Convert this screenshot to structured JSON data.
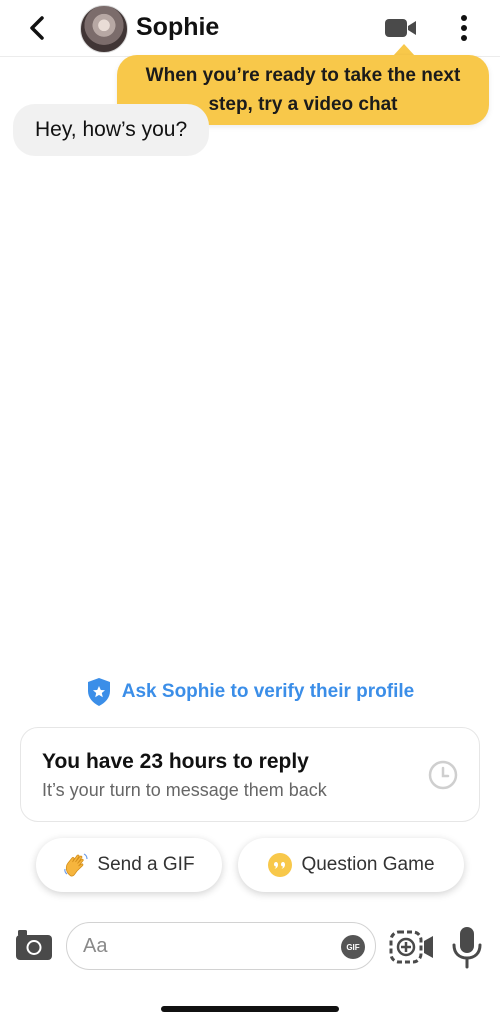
{
  "header": {
    "contact_name": "Sophie"
  },
  "tooltip": {
    "text": "When you’re ready to take the next step, try a video chat"
  },
  "messages": [
    {
      "text": "Hey, how’s you?"
    }
  ],
  "verify": {
    "text": "Ask Sophie to verify their profile"
  },
  "reply_card": {
    "title": "You have 23 hours to reply",
    "subtitle": "It’s your turn to message them back"
  },
  "chips": {
    "gif_label": "Send a GIF",
    "question_label": "Question Game"
  },
  "composer": {
    "placeholder": "Aa",
    "gif_badge": "GIF"
  },
  "colors": {
    "accent_yellow": "#f8c84a",
    "link_blue": "#3b8ee8"
  }
}
